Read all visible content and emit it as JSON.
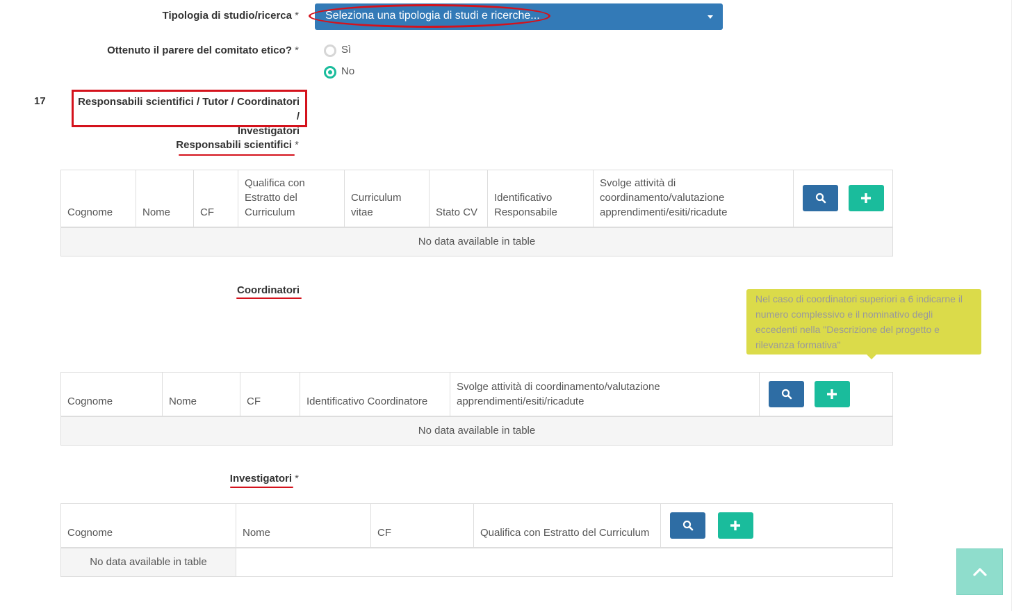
{
  "form": {
    "tipologia": {
      "label": "Tipologia di studio/ricerca",
      "required_mark": "*",
      "selected_value": "Seleziona una tipologia di studi e ricerche..."
    },
    "parere": {
      "label": "Ottenuto il parere del comitato etico?",
      "required_mark": "*",
      "options": [
        {
          "label": "Sì",
          "checked": false
        },
        {
          "label": "No",
          "checked": true
        }
      ]
    },
    "section": {
      "number": "17",
      "title_line1": "Responsabili scientifici / Tutor / Coordinatori /",
      "title_line2": "Investigatori"
    }
  },
  "responsabili": {
    "heading": "Responsabili scientifici",
    "required_mark": "*",
    "columns": [
      "Cognome",
      "Nome",
      "CF",
      "Qualifica con Estratto del Curriculum",
      "Curriculum vitae",
      "Stato CV",
      "Identificativo Responsabile",
      "Svolge attività di coordinamento/valutazione apprendimenti/esiti/ricadute"
    ],
    "empty_text": "No data available in table"
  },
  "coordinatori": {
    "heading": "Coordinatori",
    "tooltip": "Nel caso di coordinatori superiori a 6 indicarne il numero complessivo e il nominativo degli eccedenti nella \"Descrizione del progetto e rilevanza formativa\"",
    "columns": [
      "Cognome",
      "Nome",
      "CF",
      "Identificativo Coordinatore",
      "Svolge attività di coordinamento/valutazione apprendimenti/esiti/ricadute"
    ],
    "empty_text": "No data available in table"
  },
  "investigatori": {
    "heading": "Investigatori",
    "required_mark": "*",
    "columns": [
      "Cognome",
      "Nome",
      "CF",
      "Qualifica con Estratto del Curriculum"
    ],
    "empty_text": "No data available in table"
  },
  "icons": {
    "search": "search-icon",
    "add": "plus-icon",
    "scroll_top": "chevron-up-icon"
  },
  "colors": {
    "primary": "#337ab7",
    "success": "#1abc9c",
    "annotation_red": "#d4121c",
    "tooltip_bg": "#dbdb4a"
  }
}
